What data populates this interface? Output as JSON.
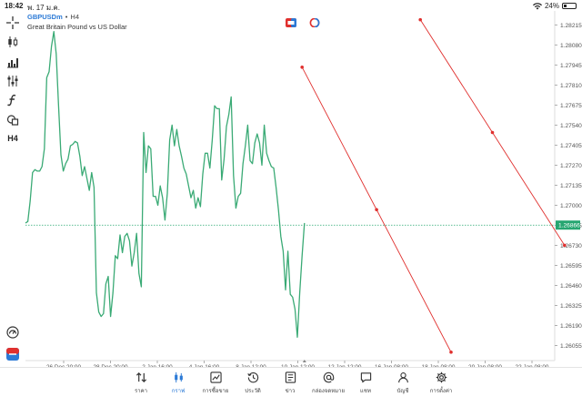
{
  "status": {
    "time": "18:42",
    "date": "พ. 17 ม.ค.",
    "battery": "24%",
    "battery_level": 0.24
  },
  "header": {
    "symbol": "GBPUSDm",
    "separator": "•",
    "timeframe": "H4",
    "description": "Great Britain Pound vs US Dollar"
  },
  "toolbar": [
    {
      "name": "crosshair-icon"
    },
    {
      "name": "candlestick-icon"
    },
    {
      "name": "volume-bars-icon"
    },
    {
      "name": "settings-sliders-icon"
    },
    {
      "name": "indicator-function-icon"
    },
    {
      "name": "shapes-icon"
    },
    {
      "name": "timeframe-button",
      "label": "H4"
    }
  ],
  "colors": {
    "price_line": "#3aaa75",
    "channel": "#e0302e",
    "price_tag": "#26a671",
    "accent": "#2c7ad6",
    "grid_text": "#555555"
  },
  "chart_data": {
    "type": "line",
    "y_ticks": [
      "1.28215",
      "1.28080",
      "1.27945",
      "1.27810",
      "1.27675",
      "1.27540",
      "1.27405",
      "1.27270",
      "1.27135",
      "1.27000",
      "1.26865",
      "1.26730",
      "1.26595",
      "1.26460",
      "1.26325",
      "1.26190",
      "1.26055"
    ],
    "current_price": "1.26866",
    "x_ticks": [
      "26 Dec 20:00",
      "28 Dec 20:00",
      "2 Jan 16:00",
      "4 Jan 16:00",
      "8 Jan 12:00",
      "10 Jan 12:00",
      "12 Jan 12:00",
      "16 Jan 08:00",
      "18 Jan 08:00",
      "20 Jan 08:00",
      "22 Jan 08:00"
    ],
    "ylim": [
      1.2599,
      1.2826
    ],
    "series": [
      {
        "values": [
          1.2688,
          1.2689,
          1.2703,
          1.2722,
          1.2724,
          1.2723,
          1.2723,
          1.2726,
          1.2738,
          1.2786,
          1.279,
          1.2807,
          1.2817,
          1.2802,
          1.2767,
          1.2734,
          1.2723,
          1.2728,
          1.2731,
          1.274,
          1.2741,
          1.2743,
          1.2742,
          1.2733,
          1.272,
          1.2726,
          1.2718,
          1.271,
          1.2722,
          1.2712,
          1.2641,
          1.2628,
          1.2625,
          1.2627,
          1.2647,
          1.2652,
          1.2625,
          1.2641,
          1.2666,
          1.2664,
          1.268,
          1.2668,
          1.2679,
          1.2681,
          1.2676,
          1.2659,
          1.2668,
          1.2681,
          1.2654,
          1.2645,
          1.2749,
          1.2722,
          1.274,
          1.2738,
          1.2706,
          1.2706,
          1.27,
          1.2713,
          1.2705,
          1.269,
          1.2708,
          1.2744,
          1.2754,
          1.274,
          1.2751,
          1.274,
          1.2733,
          1.2725,
          1.2721,
          1.2713,
          1.2705,
          1.271,
          1.2698,
          1.2705,
          1.2699,
          1.2721,
          1.2735,
          1.2735,
          1.2725,
          1.2744,
          1.2767,
          1.2765,
          1.2765,
          1.2717,
          1.2731,
          1.2753,
          1.2761,
          1.2773,
          1.272,
          1.2698,
          1.2706,
          1.2708,
          1.2728,
          1.274,
          1.2754,
          1.273,
          1.2728,
          1.2742,
          1.2748,
          1.2742,
          1.2727,
          1.2754,
          1.2735,
          1.273,
          1.2726,
          1.2725,
          1.2712,
          1.2697,
          1.2679,
          1.2669,
          1.2643,
          1.2669,
          1.264,
          1.2638,
          1.263,
          1.2611,
          1.2641,
          1.2666,
          1.2688
        ]
      }
    ],
    "channel_lines": [
      {
        "start": {
          "x_index": 117,
          "y": 1.2793
        },
        "end": {
          "x_index": 180,
          "y": 1.2601
        },
        "mid_marker": true
      },
      {
        "start": {
          "x_index": 167,
          "y": 1.2825
        },
        "end": {
          "x_index": 228,
          "y": 1.2673
        },
        "mid_marker": true
      }
    ]
  },
  "bottom_nav": [
    {
      "label": "ราคา",
      "icon": "quotes-arrows-icon",
      "active": false
    },
    {
      "label": "กราฟ",
      "icon": "chart-candles-icon",
      "active": true
    },
    {
      "label": "การซื้อขาย",
      "icon": "trade-chart-icon",
      "active": false
    },
    {
      "label": "ประวัติ",
      "icon": "history-clock-icon",
      "active": false
    },
    {
      "label": "ข่าว",
      "icon": "news-icon",
      "active": false
    },
    {
      "label": "กล่องจดหมาย",
      "icon": "mailbox-at-icon",
      "active": false
    },
    {
      "label": "แชท",
      "icon": "chat-bubble-icon",
      "active": false
    },
    {
      "label": "บัญชี",
      "icon": "account-user-icon",
      "active": false
    },
    {
      "label": "การตั้งค่า",
      "icon": "settings-gear-icon",
      "active": false
    }
  ],
  "side_bottom": [
    {
      "name": "signal-gauge-icon"
    },
    {
      "name": "one-click-trading-icon"
    }
  ]
}
